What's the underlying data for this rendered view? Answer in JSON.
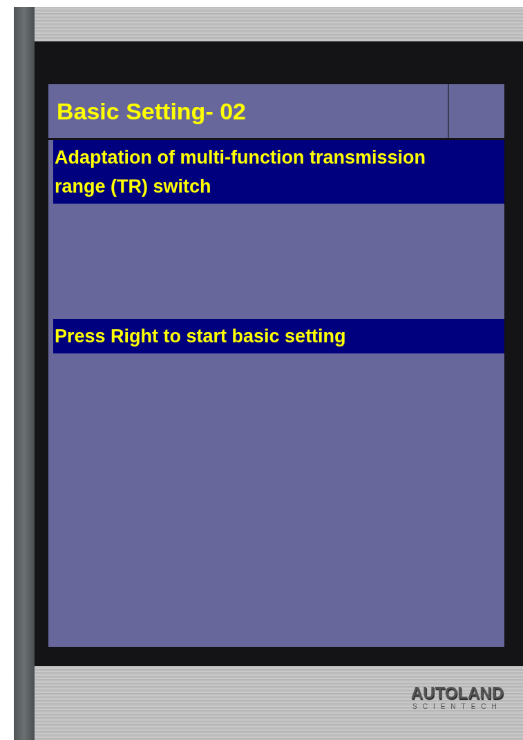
{
  "screen": {
    "title": "Basic Setting- 02",
    "lines": [
      {
        "kind": "message",
        "text": "Adaptation of multi-function transmission range (TR) switch"
      },
      {
        "kind": "spacer"
      },
      {
        "kind": "message",
        "text": "Press Right to start basic setting"
      }
    ]
  },
  "logo": {
    "name": "AUTOLAND",
    "subtitle": "SCIENTECH"
  }
}
